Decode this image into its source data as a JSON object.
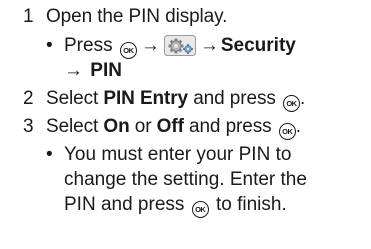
{
  "steps": [
    {
      "number": "1",
      "text": "Open the PIN display.",
      "sub": {
        "bullet": "•",
        "press": "Press",
        "arrow1": "→",
        "arrow2": "→",
        "security": "Security",
        "arrow3": "→",
        "pin": "PIN"
      }
    },
    {
      "number": "2",
      "select": "Select",
      "pin_entry": "PIN Entry",
      "and_press": "and press",
      "period": "."
    },
    {
      "number": "3",
      "select": "Select",
      "on": "On",
      "or": "or",
      "off": "Off",
      "and_press": "and press",
      "period": ".",
      "note": {
        "bullet": "•",
        "line1": "You must enter your PIN to",
        "line2": "change the setting. Enter the",
        "line3_a": "PIN and press",
        "line3_b": "to finish."
      }
    }
  ],
  "icons": {
    "ok_label": "OK",
    "ok_icon": "ok-key-icon",
    "settings_icon": "settings-gear-icon"
  }
}
